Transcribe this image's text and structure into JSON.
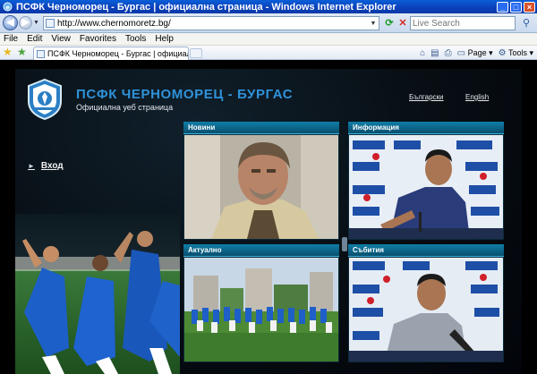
{
  "window": {
    "title": "ПСФК Черноморец - Бургас | официална страница - Windows Internet Explorer"
  },
  "address_bar": {
    "url": "http://www.chernomoretz.bg/",
    "search_placeholder": "Live Search"
  },
  "menu": {
    "items": [
      "File",
      "Edit",
      "View",
      "Favorites",
      "Tools",
      "Help"
    ]
  },
  "tabs": [
    {
      "label": "ПСФК Черноморец - Бургас | официална страница"
    }
  ],
  "command_bar": {
    "page_label": "Page",
    "tools_label": "Tools"
  },
  "site": {
    "title": "ПСФК ЧЕРНОМОРЕЦ - БУРГАС",
    "subtitle": "Официална уеб страница",
    "languages": [
      "Български",
      "English"
    ],
    "login_label": "Вход",
    "panels": [
      {
        "title": "Новини"
      },
      {
        "title": "Информация"
      },
      {
        "title": "Актуално"
      },
      {
        "title": "Събития"
      }
    ]
  },
  "colors": {
    "site_title": "#2f92d8",
    "panel_header": "#0f7ea8",
    "page_background": "#070d12"
  }
}
